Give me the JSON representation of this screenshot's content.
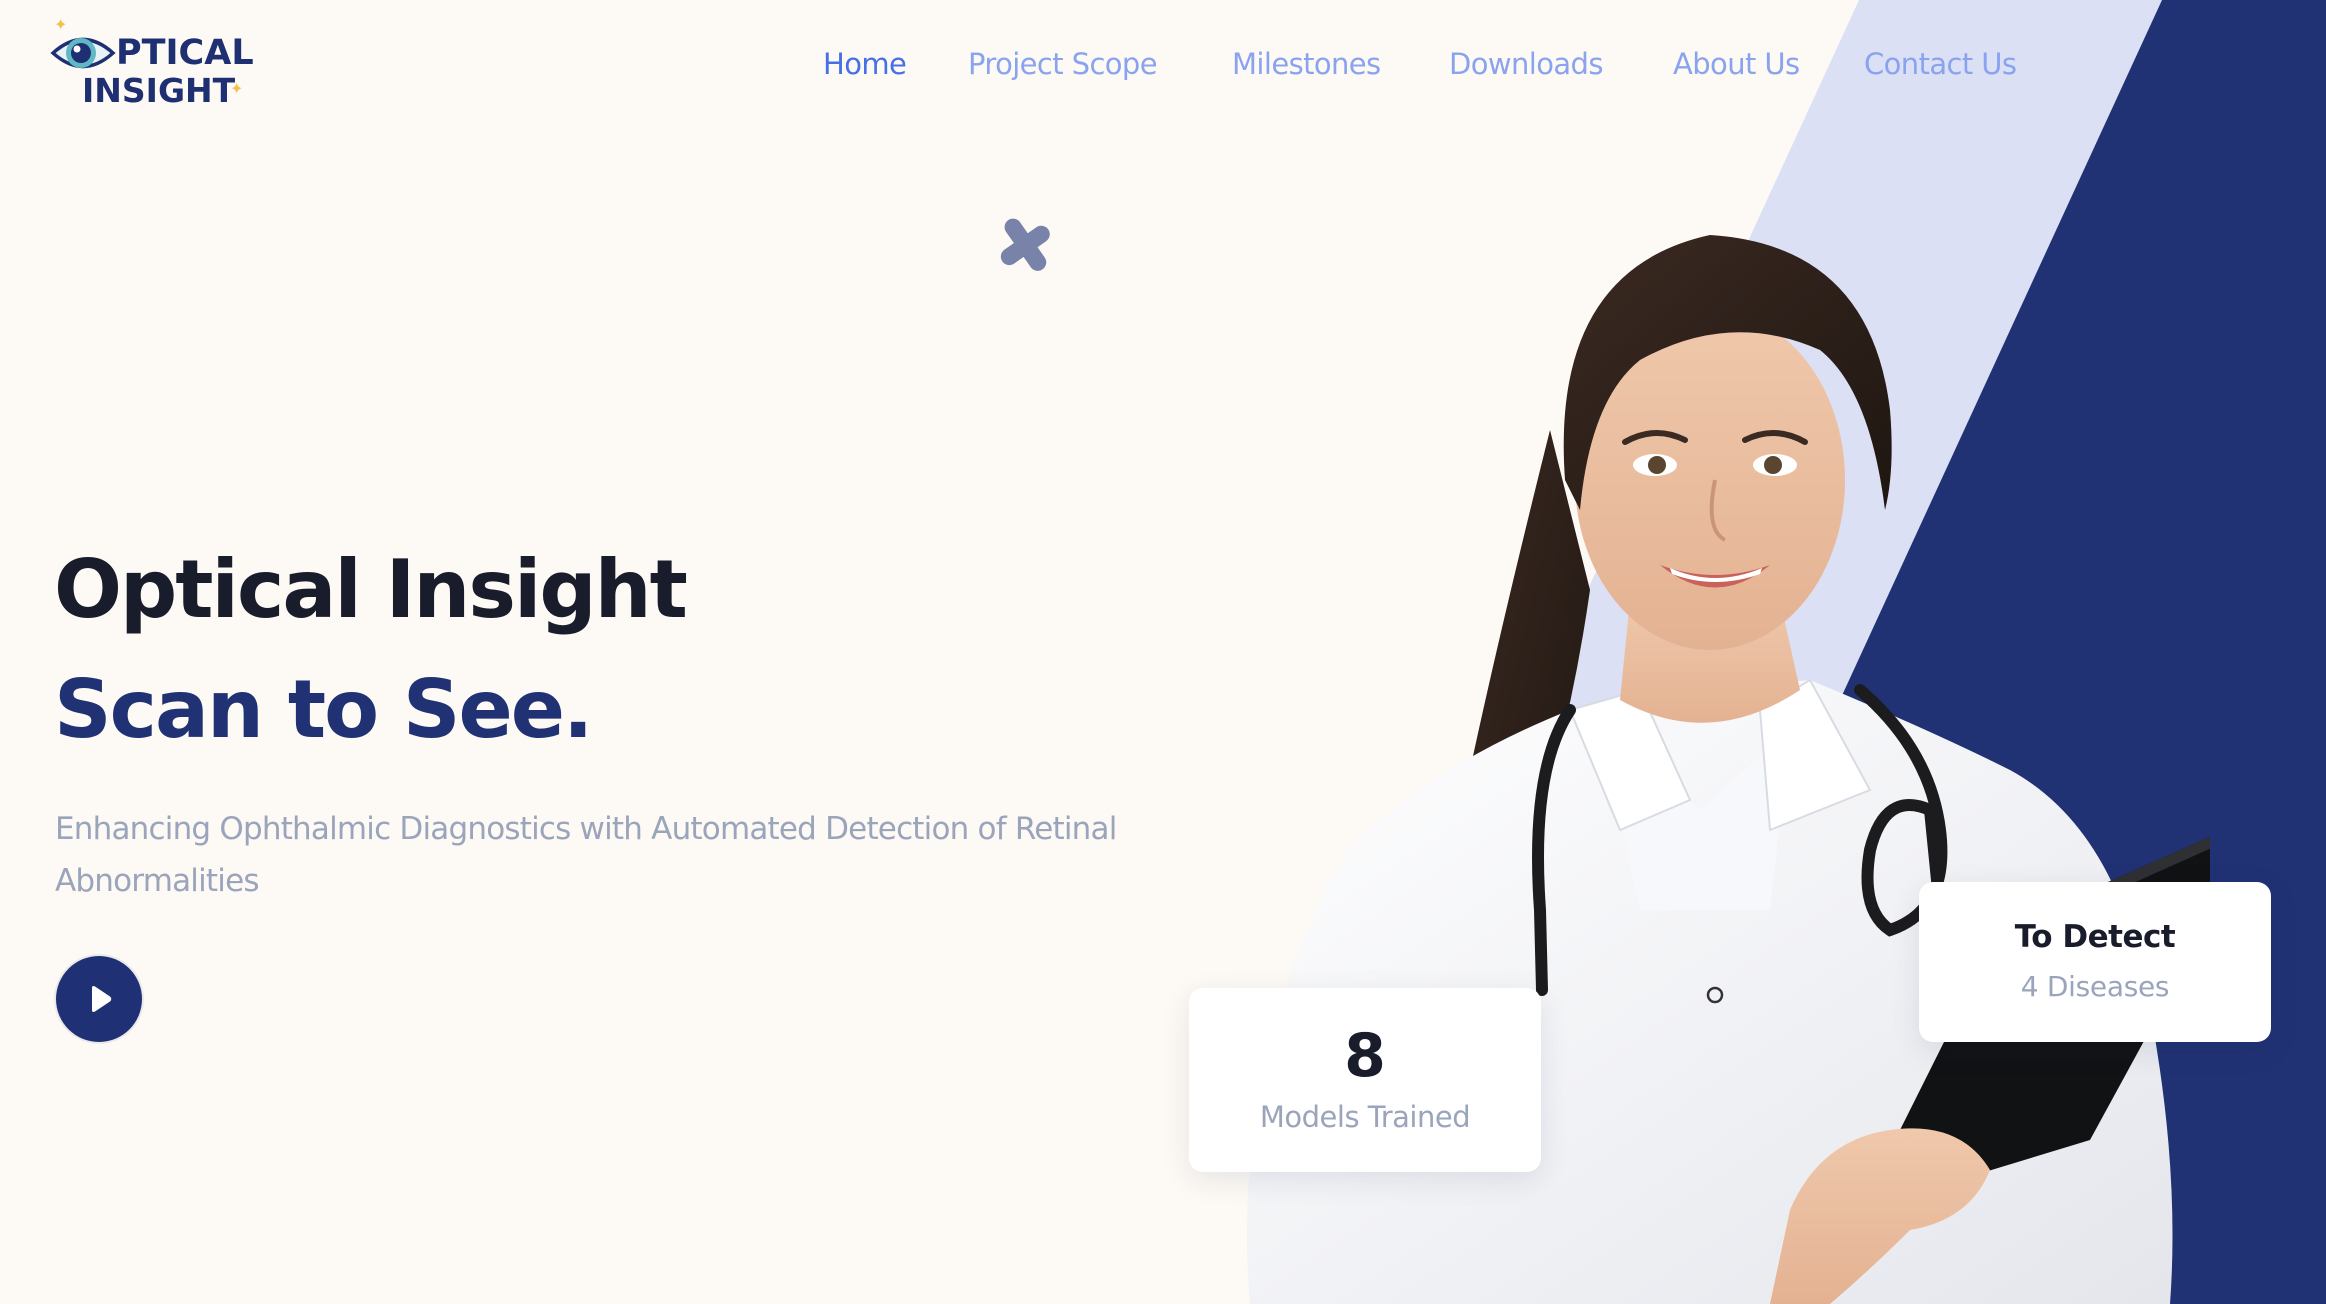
{
  "brand": {
    "name_line1": "PTICAL",
    "name_line2": "INSIGHT",
    "full_name": "Optical Insight",
    "primary_color": "#203274",
    "accent_color": "#4670e6",
    "light_band_color": "#dbe0f4",
    "sparkle_color": "#f2c14e",
    "logo_icon": "eye-icon"
  },
  "nav": {
    "items": [
      {
        "label": "Home",
        "active": true
      },
      {
        "label": "Project Scope",
        "active": false
      },
      {
        "label": "Milestones",
        "active": false
      },
      {
        "label": "Downloads",
        "active": false
      },
      {
        "label": "About Us",
        "active": false
      },
      {
        "label": "Contact Us",
        "active": false
      }
    ]
  },
  "hero": {
    "title": "Optical Insight",
    "tagline": "Scan to See.",
    "subtitle": "Enhancing Ophthalmic Diagnostics with Automated Detection of Retinal Abnormalities",
    "play_button_icon": "play-icon",
    "decoration_icon": "cross-icon",
    "image_subject": "doctor-in-white-coat-with-stethoscope-and-clipboard"
  },
  "stats": {
    "models": {
      "value": "8",
      "label": "Models Trained"
    },
    "detect": {
      "heading": "To Detect",
      "sub": "4 Diseases"
    }
  }
}
